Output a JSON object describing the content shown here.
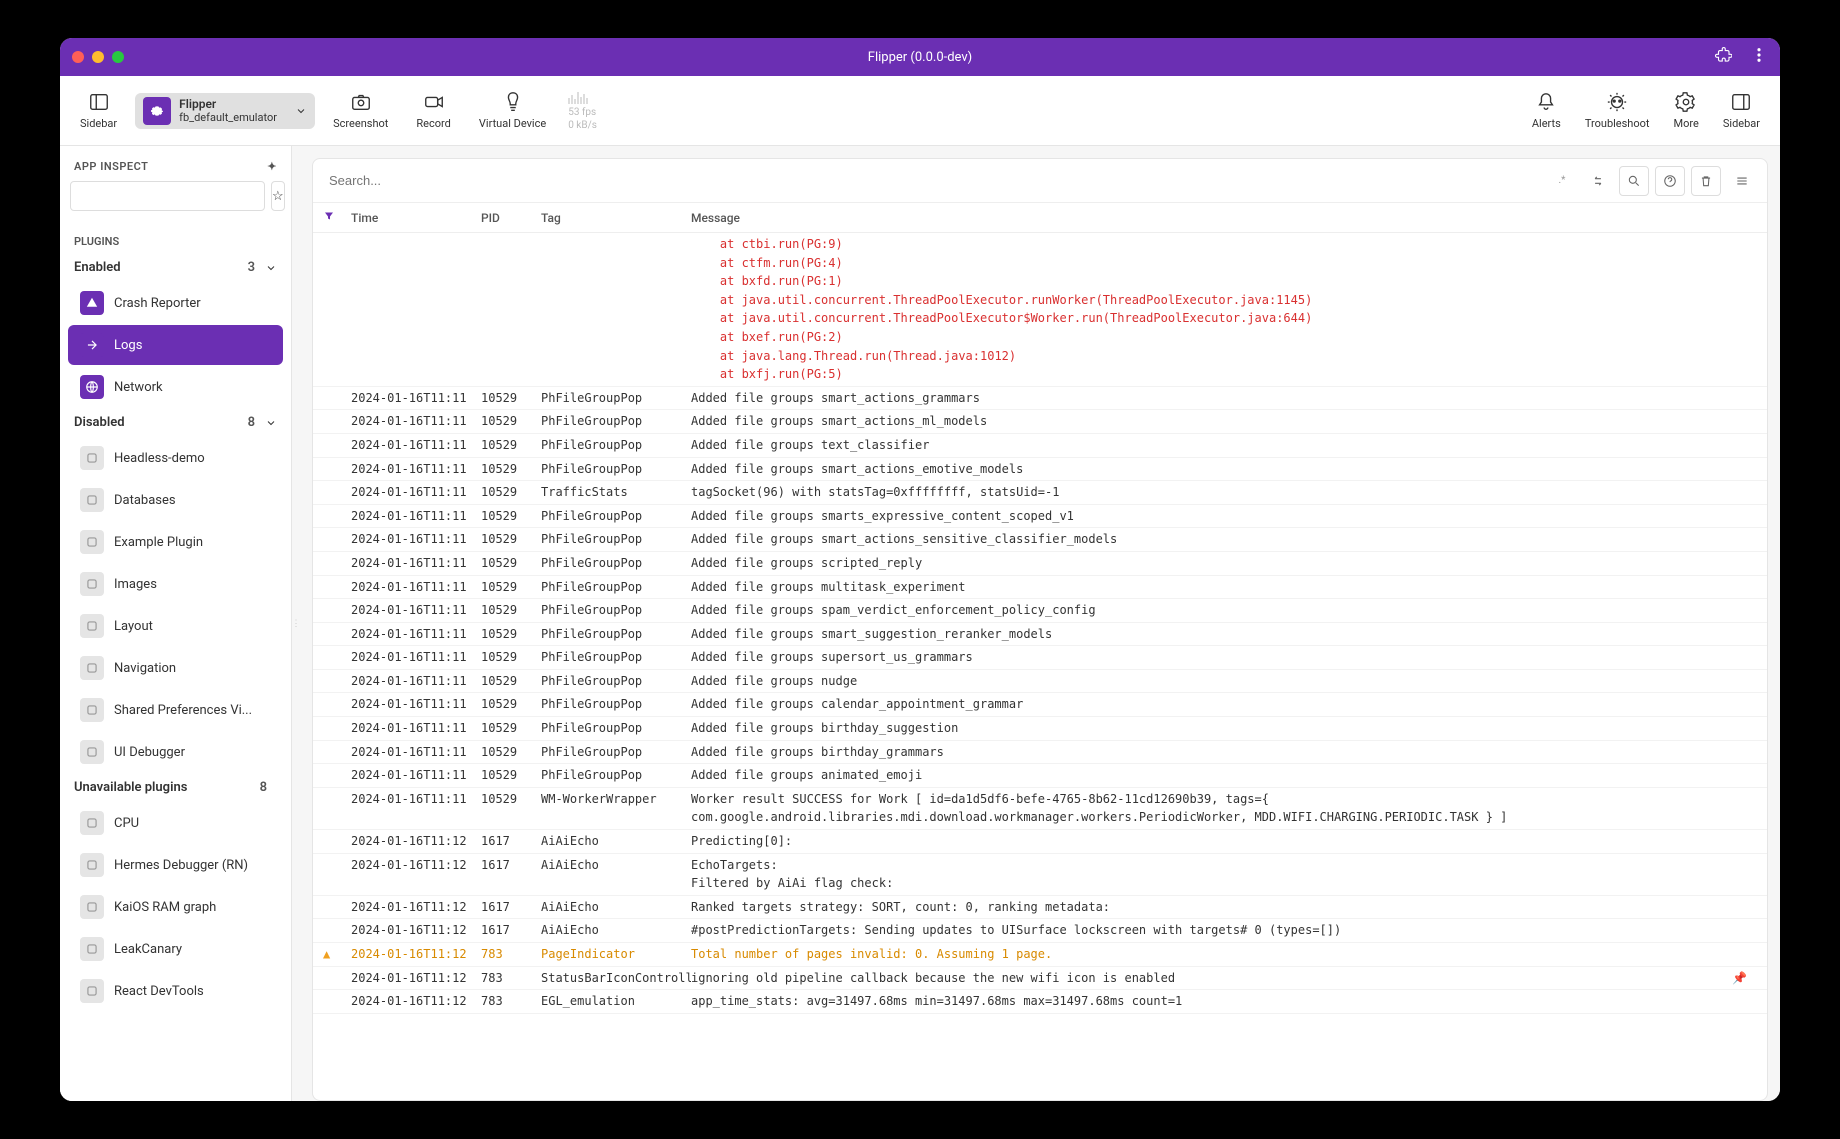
{
  "window": {
    "title": "Flipper (0.0.0-dev)"
  },
  "toolbar": {
    "sidebar_label": "Sidebar",
    "device": {
      "name": "Flipper",
      "id": "fb_default_emulator"
    },
    "screenshot": "Screenshot",
    "record": "Record",
    "virtual_device": "Virtual Device",
    "stats": {
      "fps": "53 fps",
      "data": "0 kB/s"
    },
    "alerts": "Alerts",
    "troubleshoot": "Troubleshoot",
    "more": "More",
    "sidebar_right": "Sidebar"
  },
  "sidebar": {
    "app_inspect": "APP INSPECT",
    "plugins_label": "PLUGINS",
    "enabled": {
      "label": "Enabled",
      "count": "3",
      "items": [
        {
          "label": "Crash Reporter",
          "icon": "crash",
          "color": "purple"
        },
        {
          "label": "Logs",
          "icon": "logs",
          "color": "purple",
          "active": true
        },
        {
          "label": "Network",
          "icon": "network",
          "color": "purple"
        }
      ]
    },
    "disabled": {
      "label": "Disabled",
      "count": "8",
      "items": [
        {
          "label": "Headless-demo",
          "icon": "gen"
        },
        {
          "label": "Databases",
          "icon": "gen"
        },
        {
          "label": "Example Plugin",
          "icon": "gen"
        },
        {
          "label": "Images",
          "icon": "gen"
        },
        {
          "label": "Layout",
          "icon": "gen"
        },
        {
          "label": "Navigation",
          "icon": "gen"
        },
        {
          "label": "Shared Preferences Vi...",
          "icon": "gen"
        },
        {
          "label": "UI Debugger",
          "icon": "gen"
        }
      ]
    },
    "unavailable": {
      "label": "Unavailable plugins",
      "count": "8",
      "items": [
        {
          "label": "CPU",
          "icon": "gen"
        },
        {
          "label": "Hermes Debugger (RN)",
          "icon": "gen"
        },
        {
          "label": "KaiOS RAM graph",
          "icon": "gen"
        },
        {
          "label": "LeakCanary",
          "icon": "gen"
        },
        {
          "label": "React DevTools",
          "icon": "gen"
        }
      ]
    }
  },
  "search": {
    "placeholder": "Search..."
  },
  "columns": {
    "time": "Time",
    "pid": "PID",
    "tag": "Tag",
    "msg": "Message"
  },
  "stack": [
    "    at ctbi.run(PG:9)",
    "    at ctfm.run(PG:4)",
    "    at bxfd.run(PG:1)",
    "    at java.util.concurrent.ThreadPoolExecutor.runWorker(ThreadPoolExecutor.java:1145)",
    "    at java.util.concurrent.ThreadPoolExecutor$Worker.run(ThreadPoolExecutor.java:644)",
    "    at bxef.run(PG:2)",
    "    at java.lang.Thread.run(Thread.java:1012)",
    "    at bxfj.run(PG:5)"
  ],
  "logs": [
    {
      "time": "2024-01-16T11:11",
      "pid": "10529",
      "tag": "PhFileGroupPop",
      "msg": "Added file groups smart_actions_grammars"
    },
    {
      "time": "2024-01-16T11:11",
      "pid": "10529",
      "tag": "PhFileGroupPop",
      "msg": "Added file groups smart_actions_ml_models"
    },
    {
      "time": "2024-01-16T11:11",
      "pid": "10529",
      "tag": "PhFileGroupPop",
      "msg": "Added file groups text_classifier"
    },
    {
      "time": "2024-01-16T11:11",
      "pid": "10529",
      "tag": "PhFileGroupPop",
      "msg": "Added file groups smart_actions_emotive_models"
    },
    {
      "time": "2024-01-16T11:11",
      "pid": "10529",
      "tag": "TrafficStats",
      "msg": "tagSocket(96) with statsTag=0xffffffff, statsUid=-1"
    },
    {
      "time": "2024-01-16T11:11",
      "pid": "10529",
      "tag": "PhFileGroupPop",
      "msg": "Added file groups smarts_expressive_content_scoped_v1"
    },
    {
      "time": "2024-01-16T11:11",
      "pid": "10529",
      "tag": "PhFileGroupPop",
      "msg": "Added file groups smart_actions_sensitive_classifier_models"
    },
    {
      "time": "2024-01-16T11:11",
      "pid": "10529",
      "tag": "PhFileGroupPop",
      "msg": "Added file groups scripted_reply"
    },
    {
      "time": "2024-01-16T11:11",
      "pid": "10529",
      "tag": "PhFileGroupPop",
      "msg": "Added file groups multitask_experiment"
    },
    {
      "time": "2024-01-16T11:11",
      "pid": "10529",
      "tag": "PhFileGroupPop",
      "msg": "Added file groups spam_verdict_enforcement_policy_config"
    },
    {
      "time": "2024-01-16T11:11",
      "pid": "10529",
      "tag": "PhFileGroupPop",
      "msg": "Added file groups smart_suggestion_reranker_models"
    },
    {
      "time": "2024-01-16T11:11",
      "pid": "10529",
      "tag": "PhFileGroupPop",
      "msg": "Added file groups supersort_us_grammars"
    },
    {
      "time": "2024-01-16T11:11",
      "pid": "10529",
      "tag": "PhFileGroupPop",
      "msg": "Added file groups nudge"
    },
    {
      "time": "2024-01-16T11:11",
      "pid": "10529",
      "tag": "PhFileGroupPop",
      "msg": "Added file groups calendar_appointment_grammar"
    },
    {
      "time": "2024-01-16T11:11",
      "pid": "10529",
      "tag": "PhFileGroupPop",
      "msg": "Added file groups birthday_suggestion"
    },
    {
      "time": "2024-01-16T11:11",
      "pid": "10529",
      "tag": "PhFileGroupPop",
      "msg": "Added file groups birthday_grammars"
    },
    {
      "time": "2024-01-16T11:11",
      "pid": "10529",
      "tag": "PhFileGroupPop",
      "msg": "Added file groups animated_emoji"
    },
    {
      "time": "2024-01-16T11:11",
      "pid": "10529",
      "tag": "WM-WorkerWrapper",
      "msg": "Worker result SUCCESS for Work [ id=da1d5df6-befe-4765-8b62-11cd12690b39, tags={ com.google.android.libraries.mdi.download.workmanager.workers.PeriodicWorker, MDD.WIFI.CHARGING.PERIODIC.TASK } ]"
    },
    {
      "time": "2024-01-16T11:12",
      "pid": "1617",
      "tag": "AiAiEcho",
      "msg": "Predicting[0]:"
    },
    {
      "time": "2024-01-16T11:12",
      "pid": "1617",
      "tag": "AiAiEcho",
      "msg": "EchoTargets:\nFiltered by AiAi flag check:"
    },
    {
      "time": "2024-01-16T11:12",
      "pid": "1617",
      "tag": "AiAiEcho",
      "msg": "Ranked targets strategy: SORT, count: 0, ranking metadata:"
    },
    {
      "time": "2024-01-16T11:12",
      "pid": "1617",
      "tag": "AiAiEcho",
      "msg": "#postPredictionTargets: Sending updates to UISurface lockscreen with targets# 0 (types=[])"
    },
    {
      "time": "2024-01-16T11:12",
      "pid": "783",
      "tag": "PageIndicator",
      "msg": "Total number of pages invalid: 0. Assuming 1 page.",
      "level": "warn"
    },
    {
      "time": "2024-01-16T11:12",
      "pid": "783",
      "tag": "StatusBarIconControll",
      "msg": "ignoring old pipeline callback because the new wifi icon is enabled",
      "pin": true
    },
    {
      "time": "2024-01-16T11:12",
      "pid": "783",
      "tag": "EGL_emulation",
      "msg": "app_time_stats: avg=31497.68ms min=31497.68ms max=31497.68ms count=1"
    }
  ]
}
